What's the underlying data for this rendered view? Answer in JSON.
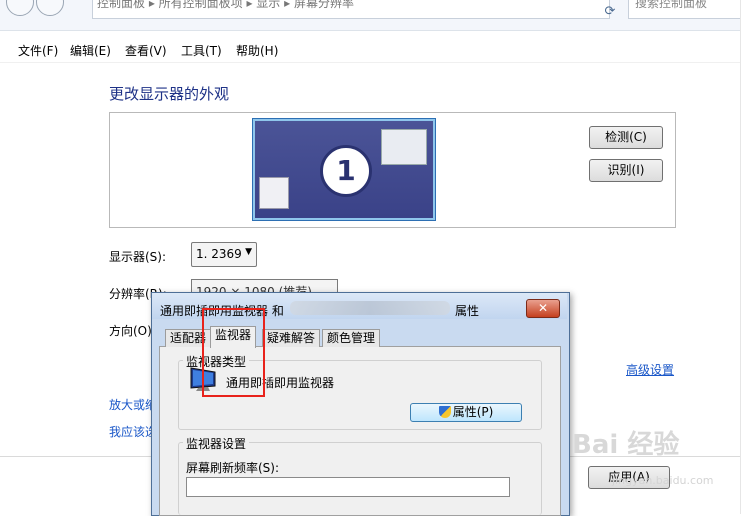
{
  "address_bar": {
    "crumbs": "控制面板  ▸  所有控制面板项  ▸  显示  ▸  屏幕分辨率",
    "search_placeholder": "搜索控制面板"
  },
  "menu": [
    "文件(F)",
    "编辑(E)",
    "查看(V)",
    "工具(T)",
    "帮助(H)"
  ],
  "page": {
    "heading": "更改显示器的外观",
    "monitor_number": "1",
    "detect_button": "检测(C)",
    "identify_button": "识别(I)",
    "display_label": "显示器(S):",
    "display_value": "1. 2369",
    "resolution_label": "分辨率(R):",
    "resolution_value": "1920 × 1080 (推荐)",
    "orientation_label": "方向(O)",
    "advanced_link": "高级设置",
    "link1": "放大或缩",
    "link2": "我应该选",
    "apply_button": "应用(A)"
  },
  "dialog": {
    "title_prefix": "通用即插即用监视器 和",
    "title_suffix": "属性",
    "close": "✕",
    "tabs": [
      "适配器",
      "监视器",
      "疑难解答",
      "颜色管理"
    ],
    "group1_title": "监视器类型",
    "monitor_name": "通用即插即用监视器",
    "properties_button": "属性(P)",
    "group2_title": "监视器设置",
    "refresh_label": "屏幕刷新频率(S):"
  },
  "watermark": {
    "text": "Bai 经验",
    "url": "jingyan.baidu.com"
  },
  "colors": {
    "heading": "#1e3287",
    "link": "#1a57c8",
    "highlight_box": "#e8221b"
  }
}
